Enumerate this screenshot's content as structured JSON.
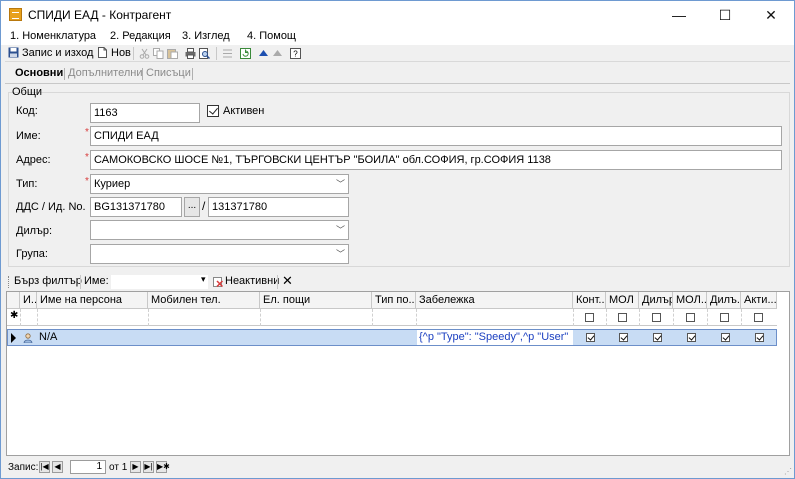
{
  "window": {
    "title": "СПИДИ ЕАД - Контрагент",
    "minimize": "—",
    "maximize": "☐",
    "close": "✕"
  },
  "menu": [
    "1. Номенклатура",
    "2. Редакция",
    "3. Изглед",
    "4. Помощ"
  ],
  "toolbar": {
    "save_exit_label": "Запис и изход",
    "new_label": "Нов"
  },
  "tabs": [
    "Основни",
    "Допълнителни",
    "Списъци"
  ],
  "group": {
    "title": "Общи"
  },
  "form": {
    "code_label": "Код:",
    "code_value": "1163",
    "active_label": "Активен",
    "active_checked": true,
    "name_label": "Име:",
    "name_value": "СПИДИ ЕАД",
    "address_label": "Адрес:",
    "address_value": "САМОКОВСКО ШОСЕ  №1,  ТЪРГОВСКИ ЦЕНТЪР \"БОИЛА\" обл.СОФИЯ, гр.СОФИЯ 1138",
    "type_label": "Тип:",
    "type_value": "Куриер",
    "vat_label": "ДДС / Ид. No.",
    "vat_value": "BG131371780",
    "lookup_button": "...",
    "vat_slash": "/",
    "id_value": "131371780",
    "dealer_label": "Дилър:",
    "dealer_value": "",
    "group_label": "Група:",
    "group_value": "",
    "required_mark": "*"
  },
  "filter": {
    "quick_filter_label": "Бърз филтър",
    "name_label": "Име:",
    "name_value": "",
    "inactive_label": "Неактивни",
    "clear_label": "✕"
  },
  "grid": {
    "columns": [
      "И...",
      "Име на персона",
      "Мобилен тел.",
      "Ел. пощи",
      "Тип по...",
      "Забележка",
      "Конт...",
      "МОЛ",
      "Дилър",
      "МОЛ...",
      "Дилъ...",
      "Акти..."
    ],
    "new_row_marker": "✱",
    "rows": [
      {
        "name": "N/A",
        "mobile": "",
        "email": "",
        "type": "",
        "note": "{^p    \"Type\": \"Speedy\",^p    \"User\"",
        "flags": [
          true,
          true,
          true,
          true,
          true,
          true
        ]
      }
    ]
  },
  "status": {
    "record_label": "Запис:",
    "current": "1",
    "of_label": "от 1"
  },
  "colors": {
    "selection": "#c8dcf4",
    "selection_border": "#6c8fc9",
    "required": "#d83b3b",
    "note_text": "#1b3fc0"
  }
}
